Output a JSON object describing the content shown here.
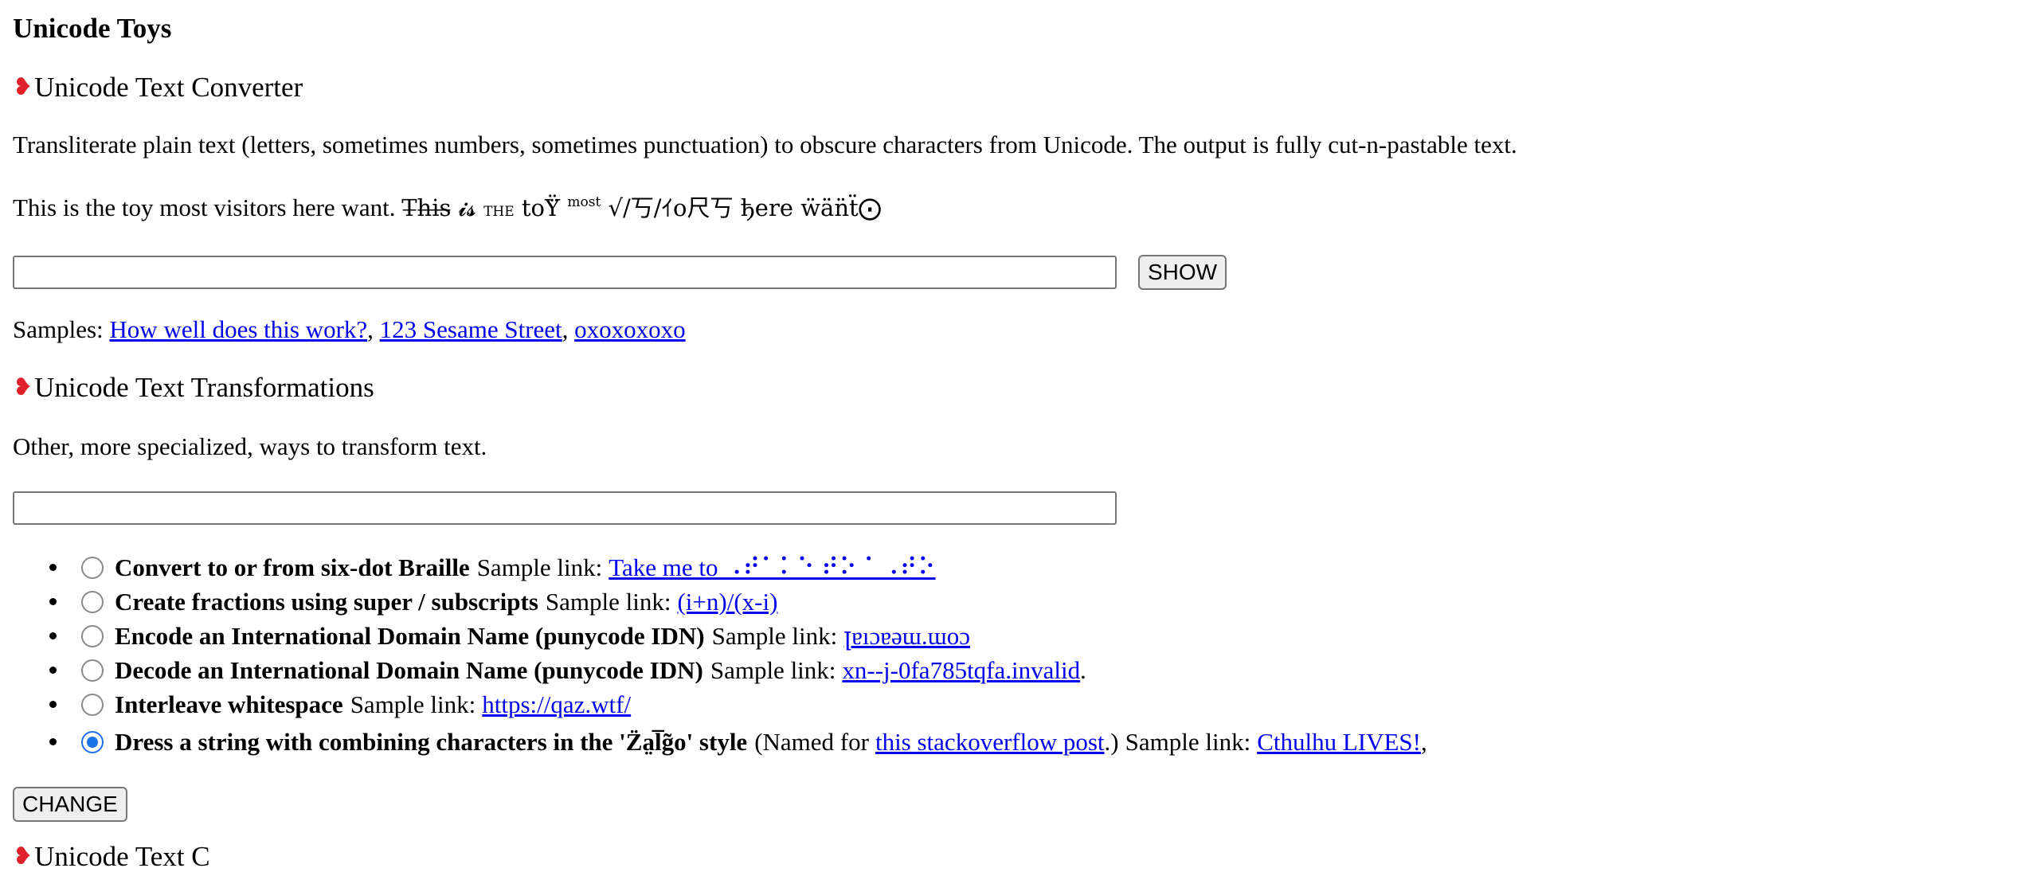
{
  "page_title": "Unicode Toys",
  "converter": {
    "heading": "Unicode Text Converter",
    "description": "Transliterate plain text (letters, sometimes numbers, sometimes punctuation) to obscure characters from Unicode. The output is fully cut-n-pastable text.",
    "intro_plain": "This is the toy most visitors here want.",
    "fancy": {
      "w1": "T̶h̶i̶s̶",
      "w2": "𝓲𝓼",
      "w3": "the",
      "w4": "toŸ̈",
      "w5": "most",
      "w6": "√/丂/ｲo尺丂",
      "w7": "ђere",
      "w8": "ẅän̈ẗ",
      "w9": "⨀"
    },
    "input_value": "",
    "show_button": "SHOW",
    "samples_label": "Samples:",
    "samples": [
      "How well does this work?",
      "123 Sesame Street",
      "oxoxoxoxo"
    ]
  },
  "transformations": {
    "heading": "Unicode Text Transformations",
    "description": "Other, more specialized, ways to transform text.",
    "input_value": "",
    "sample_link_label": "Sample link:",
    "options": [
      {
        "label": "Convert to or from six-dot Braille",
        "sample": "Take me to ⠠⠞⠁⠅⠑ ⠞⠕ ⠁⠠⠞⠕",
        "checked": false
      },
      {
        "label": "Create fractions using super / subscripts",
        "sample": "(i+n)/(x-i)",
        "checked": false
      },
      {
        "label": "Encode an International Domain Name (punycode IDN)",
        "sample": "ꞁɐıɔɐǝɯ.ɯoɔ",
        "checked": false
      },
      {
        "label": "Decode an International Domain Name (punycode IDN)",
        "sample": "xn--j-0fa785tqfa.invalid",
        "suffix": ".",
        "checked": false
      },
      {
        "label": "Interleave whitespace",
        "sample": "https://qaz.wtf/",
        "checked": false
      },
      {
        "label": "Dress a string with combining characters in the 'Z̈a̤l̅g̃o' style",
        "named_prefix": "(Named for",
        "named_link": "this stackoverflow post",
        "named_suffix": ".)",
        "sample": "Cthulhu LIVES!",
        "suffix": ",",
        "checked": true
      }
    ],
    "change_button": "CHANGE",
    "next_heading_partial": "Unicode Text C"
  },
  "colors": {
    "link": "#0000ee",
    "heart": "#e0202a",
    "radio_checked": "#1a73e8"
  },
  "icons": {
    "section_marker": "heart-icon"
  }
}
